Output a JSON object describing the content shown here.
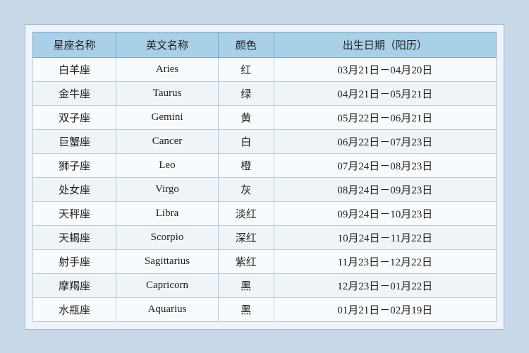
{
  "table": {
    "headers": [
      {
        "key": "zh_name",
        "label": "星座名称"
      },
      {
        "key": "en_name",
        "label": "英文名称"
      },
      {
        "key": "color",
        "label": "颜色"
      },
      {
        "key": "date",
        "label": "出生日期（阳历）"
      }
    ],
    "rows": [
      {
        "zh": "白羊座",
        "en": "Aries",
        "color": "红",
        "date": "03月21日－04月20日"
      },
      {
        "zh": "金牛座",
        "en": "Taurus",
        "color": "绿",
        "date": "04月21日－05月21日"
      },
      {
        "zh": "双子座",
        "en": "Gemini",
        "color": "黄",
        "date": "05月22日－06月21日"
      },
      {
        "zh": "巨蟹座",
        "en": "Cancer",
        "color": "白",
        "date": "06月22日－07月23日"
      },
      {
        "zh": "狮子座",
        "en": "Leo",
        "color": "橙",
        "date": "07月24日－08月23日"
      },
      {
        "zh": "处女座",
        "en": "Virgo",
        "color": "灰",
        "date": "08月24日－09月23日"
      },
      {
        "zh": "天秤座",
        "en": "Libra",
        "color": "淡红",
        "date": "09月24日－10月23日"
      },
      {
        "zh": "天蝎座",
        "en": "Scorpio",
        "color": "深红",
        "date": "10月24日－11月22日"
      },
      {
        "zh": "射手座",
        "en": "Sagittarius",
        "color": "紫红",
        "date": "11月23日－12月22日"
      },
      {
        "zh": "摩羯座",
        "en": "Capricorn",
        "color": "黑",
        "date": "12月23日－01月22日"
      },
      {
        "zh": "水瓶座",
        "en": "Aquarius",
        "color": "黑",
        "date": "01月21日－02月19日"
      }
    ]
  }
}
